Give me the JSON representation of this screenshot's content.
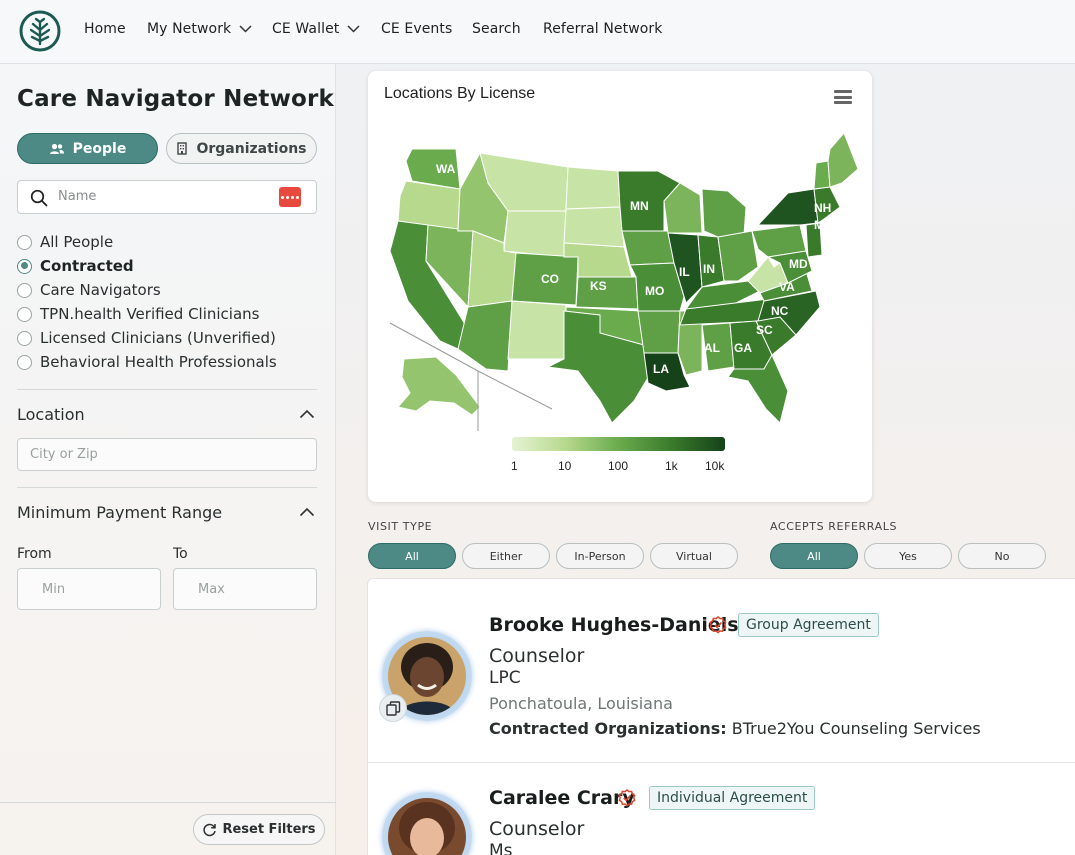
{
  "nav": {
    "home": "Home",
    "my_network": "My Network",
    "ce_wallet": "CE Wallet",
    "ce_events": "CE Events",
    "search": "Search",
    "referral_network": "Referral Network"
  },
  "sidebar": {
    "title": "Care Navigator Network",
    "people_btn": "People",
    "orgs_btn": "Organizations",
    "search_placeholder": "Name",
    "filters": [
      {
        "label": "All People",
        "selected": false
      },
      {
        "label": "Contracted",
        "selected": true
      },
      {
        "label": "Care Navigators",
        "selected": false
      },
      {
        "label": "TPN.health Verified Clinicians",
        "selected": false
      },
      {
        "label": "Licensed Clinicians (Unverified)",
        "selected": false
      },
      {
        "label": "Behavioral Health Professionals",
        "selected": false
      }
    ],
    "location_head": "Location",
    "location_placeholder": "City or Zip",
    "payment_head": "Minimum Payment Range",
    "from_label": "From",
    "to_label": "To",
    "min_placeholder": "Min",
    "max_placeholder": "Max",
    "reset_label": "Reset Filters"
  },
  "map": {
    "title": "Locations By License",
    "state_labels": [
      "WA",
      "MN",
      "NH",
      "MA",
      "CO",
      "KS",
      "IL",
      "IN",
      "MO",
      "MD",
      "VA",
      "NC",
      "SC",
      "AL",
      "GA",
      "LA"
    ],
    "legend": [
      "1",
      "10",
      "100",
      "1k",
      "10k"
    ],
    "colors": {
      "lightest": "#e5f3d4",
      "light": "#b7d98d",
      "mid": "#6aab4d",
      "dark": "#3a7b2b",
      "darkest": "#16421a"
    }
  },
  "filters": {
    "visit_type_label": "VISIT TYPE",
    "visit_types": [
      "All",
      "Either",
      "In-Person",
      "Virtual"
    ],
    "accepts_label": "ACCEPTS REFERRALS",
    "accepts": [
      "All",
      "Yes",
      "No"
    ]
  },
  "results": [
    {
      "name": "Brooke Hughes-Daniels",
      "agreement": "Group Agreement",
      "role": "Counselor",
      "credential": "LPC",
      "location": "Ponchatoula, Louisiana",
      "org_label": "Contracted Organizations:",
      "org_value": "BTrue2You Counseling Services"
    },
    {
      "name": "Caralee Crary",
      "agreement": "Individual Agreement",
      "role": "Counselor",
      "credential": "Ms"
    }
  ],
  "accent": "#4d8a86"
}
